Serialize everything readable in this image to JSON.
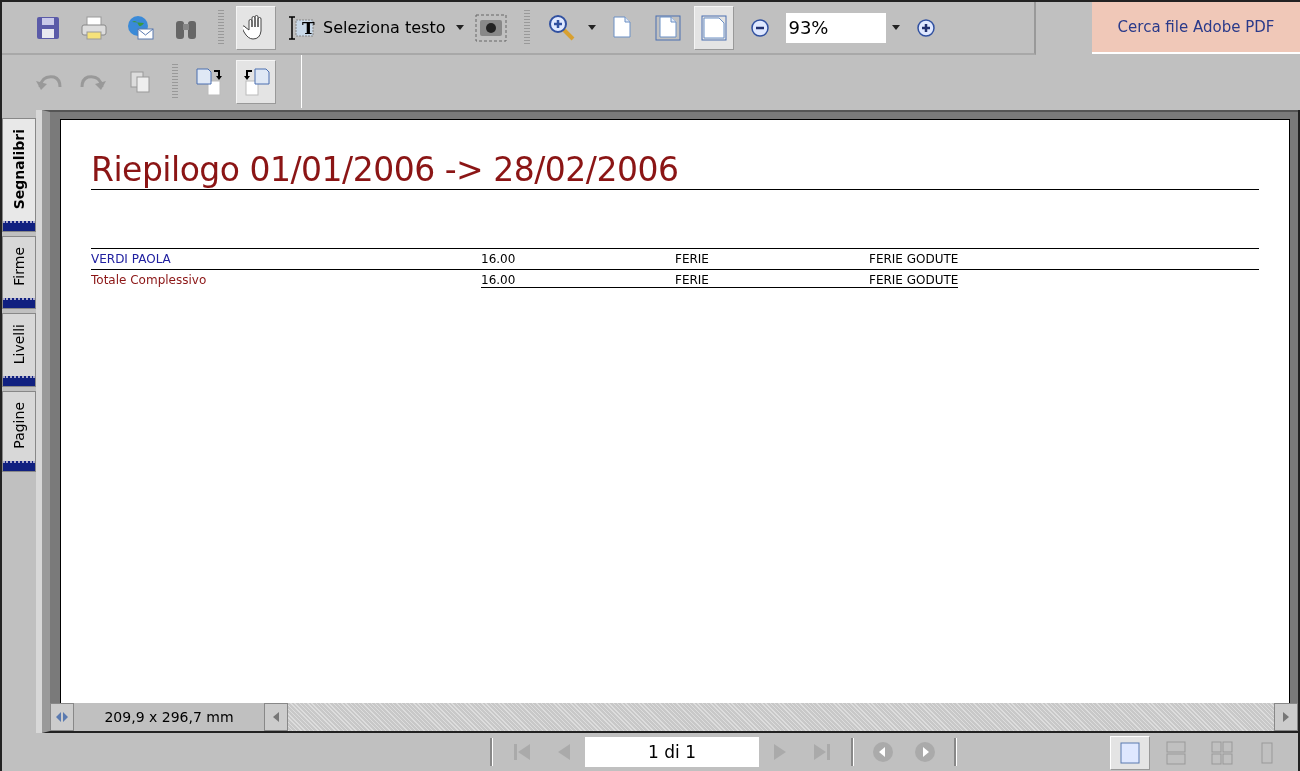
{
  "toolbar": {
    "row1": [
      {
        "kind": "save",
        "selected": false
      },
      {
        "kind": "print",
        "selected": false
      },
      {
        "kind": "email",
        "selected": false
      },
      {
        "kind": "find",
        "selected": false
      },
      {
        "kind": "grip"
      },
      {
        "kind": "hand",
        "selected": true
      },
      {
        "kind": "select",
        "glyph": "T",
        "label": "Seleziona testo",
        "selected": false
      },
      {
        "kind": "snapshot",
        "selected": false
      },
      {
        "kind": "grip"
      },
      {
        "kind": "zoomin",
        "selected": false
      },
      {
        "kind": "page",
        "selected": false
      },
      {
        "kind": "pagewidth",
        "selected": false
      },
      {
        "kind": "pagefit",
        "selected": true
      },
      {
        "kind": "zoomout",
        "selected": false
      },
      {
        "kind": "zoomfield",
        "value": "93%"
      },
      {
        "kind": "plus",
        "selected": false
      }
    ],
    "row2": [
      {
        "kind": "undo",
        "selected": false
      },
      {
        "kind": "redo",
        "selected": false
      },
      {
        "kind": "copy",
        "selected": false
      },
      {
        "kind": "grip"
      },
      {
        "kind": "rotatecw",
        "selected": false
      },
      {
        "kind": "rotateccw",
        "selected": true
      }
    ],
    "search_button": "Cerca file Adobe PDF"
  },
  "side_tabs": [
    {
      "label": "Segnalibri",
      "selected": true
    },
    {
      "label": "Firme",
      "selected": false
    },
    {
      "label": "Livelli",
      "selected": false
    },
    {
      "label": "Pagine",
      "selected": false
    }
  ],
  "document": {
    "title": "Riepilogo 01/01/2006 -> 28/02/2006",
    "rows": [
      {
        "kind": "detail",
        "cells": [
          "VERDI PAOLA",
          "16.00",
          "FERIE",
          "FERIE GODUTE"
        ]
      },
      {
        "kind": "total",
        "cells": [
          "Totale Complessivo",
          "16.00",
          "FERIE",
          "FERIE GODUTE"
        ]
      }
    ]
  },
  "page_size": "209,9 x 296,7 mm",
  "status_bar": {
    "page_field": "1 di 1",
    "views": [
      {
        "kind": "single",
        "selected": true
      },
      {
        "kind": "continuous",
        "selected": false
      },
      {
        "kind": "facing",
        "selected": false
      },
      {
        "kind": "partial",
        "selected": false
      }
    ]
  }
}
